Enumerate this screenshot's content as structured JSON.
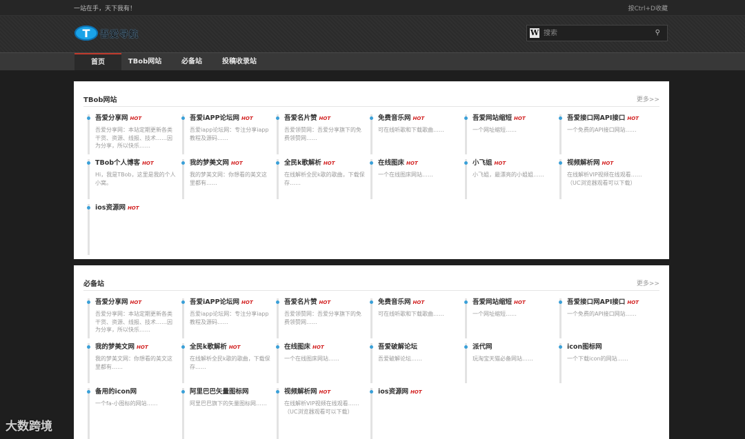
{
  "topbar": {
    "slogan": "一站在手，天下我有！",
    "favorite": "按Ctrl+D收藏"
  },
  "logo": {
    "mark": "T",
    "text": "吾爱导航"
  },
  "search": {
    "placeholder": "搜索",
    "icon": "search-icon"
  },
  "nav": [
    {
      "label": "首页",
      "active": true
    },
    {
      "label": "TBob网站",
      "active": false
    },
    {
      "label": "必备站",
      "active": false
    },
    {
      "label": "投稿收录站",
      "active": false
    }
  ],
  "hot_badge": "HOT",
  "sections": [
    {
      "title": "TBob网站",
      "more": "更多>>",
      "items": [
        {
          "name": "吾爱分享网",
          "hot": true,
          "desc": "吾爱分享网：本站定期更新各类干货、资源、线报、技术……因为分享，所以快乐……"
        },
        {
          "name": "吾爱iAPP论坛网",
          "hot": true,
          "desc": "吾爱iapp论坛网：专注分享iapp教程及源码……"
        },
        {
          "name": "吾爱名片赞",
          "hot": true,
          "desc": "吾爱领赞网：吾爱分享旗下的免费领赞网……"
        },
        {
          "name": "免费音乐网",
          "hot": true,
          "desc": "可在线听歌和下载歌曲……"
        },
        {
          "name": "吾爱网站缩短",
          "hot": true,
          "desc": "一个网址缩短……"
        },
        {
          "name": "吾爱接口网API接口",
          "hot": true,
          "desc": "一个免费的API接口网站……"
        },
        {
          "name": "TBob个人博客",
          "hot": true,
          "desc": "Hi，我是TBob，这里是我的个人小窝。"
        },
        {
          "name": "我的梦美文网",
          "hot": true,
          "desc": "我的梦美文网：你想看的美文这里都有……"
        },
        {
          "name": "全民k歌解析",
          "hot": true,
          "desc": "在线解析全民k歌的歌曲，下载保存……"
        },
        {
          "name": "在线图床",
          "hot": true,
          "desc": "一个在线图床网站……"
        },
        {
          "name": "小飞姐",
          "hot": true,
          "desc": "小飞姐，最漂亮的小姐姐……"
        },
        {
          "name": "视频解析网",
          "hot": true,
          "desc": "在线解析VIP视频在线观看……（UC浏览器观看可以下载）"
        },
        {
          "name": "ios资源网",
          "hot": true,
          "desc": ""
        }
      ]
    },
    {
      "title": "必备站",
      "more": "更多>>",
      "items": [
        {
          "name": "吾爱分享网",
          "hot": true,
          "desc": "吾爱分享网：本站定期更新各类干货、资源、线报、技术……因为分享，所以快乐……"
        },
        {
          "name": "吾爱iAPP论坛网",
          "hot": true,
          "desc": "吾爱iapp论坛网：专注分享iapp教程及源码……"
        },
        {
          "name": "吾爱名片赞",
          "hot": true,
          "desc": "吾爱领赞网：吾爱分享旗下的免费领赞网……"
        },
        {
          "name": "免费音乐网",
          "hot": true,
          "desc": "可在线听歌和下载歌曲……"
        },
        {
          "name": "吾爱网站缩短",
          "hot": true,
          "desc": "一个网址缩短……"
        },
        {
          "name": "吾爱接口网API接口",
          "hot": true,
          "desc": "一个免费的API接口网站……"
        },
        {
          "name": "我的梦美文网",
          "hot": true,
          "desc": "我的梦美文网：你想看的美文这里都有……"
        },
        {
          "name": "全民k歌解析",
          "hot": true,
          "desc": "在线解析全民k歌的歌曲，下载保存……"
        },
        {
          "name": "在线图床",
          "hot": true,
          "desc": "一个在线图床网站……"
        },
        {
          "name": "吾爱破解论坛",
          "hot": false,
          "desc": "吾爱破解论坛……"
        },
        {
          "name": "派代网",
          "hot": false,
          "desc": "玩淘宝天猫必备网站……"
        },
        {
          "name": "icon图标网",
          "hot": false,
          "desc": "一个下载icon的网站……"
        },
        {
          "name": "备用的icon网",
          "hot": false,
          "desc": "一个fa-小图标的网站……"
        },
        {
          "name": "阿里巴巴矢量图标网",
          "hot": false,
          "desc": "阿里巴巴旗下的矢量图标网……"
        },
        {
          "name": "视频解析网",
          "hot": true,
          "desc": "在线解析VIP视频在线观看……（UC浏览器观看可以下载）"
        },
        {
          "name": "ios资源网",
          "hot": true,
          "desc": ""
        }
      ]
    }
  ],
  "watermark": "大数跨境"
}
